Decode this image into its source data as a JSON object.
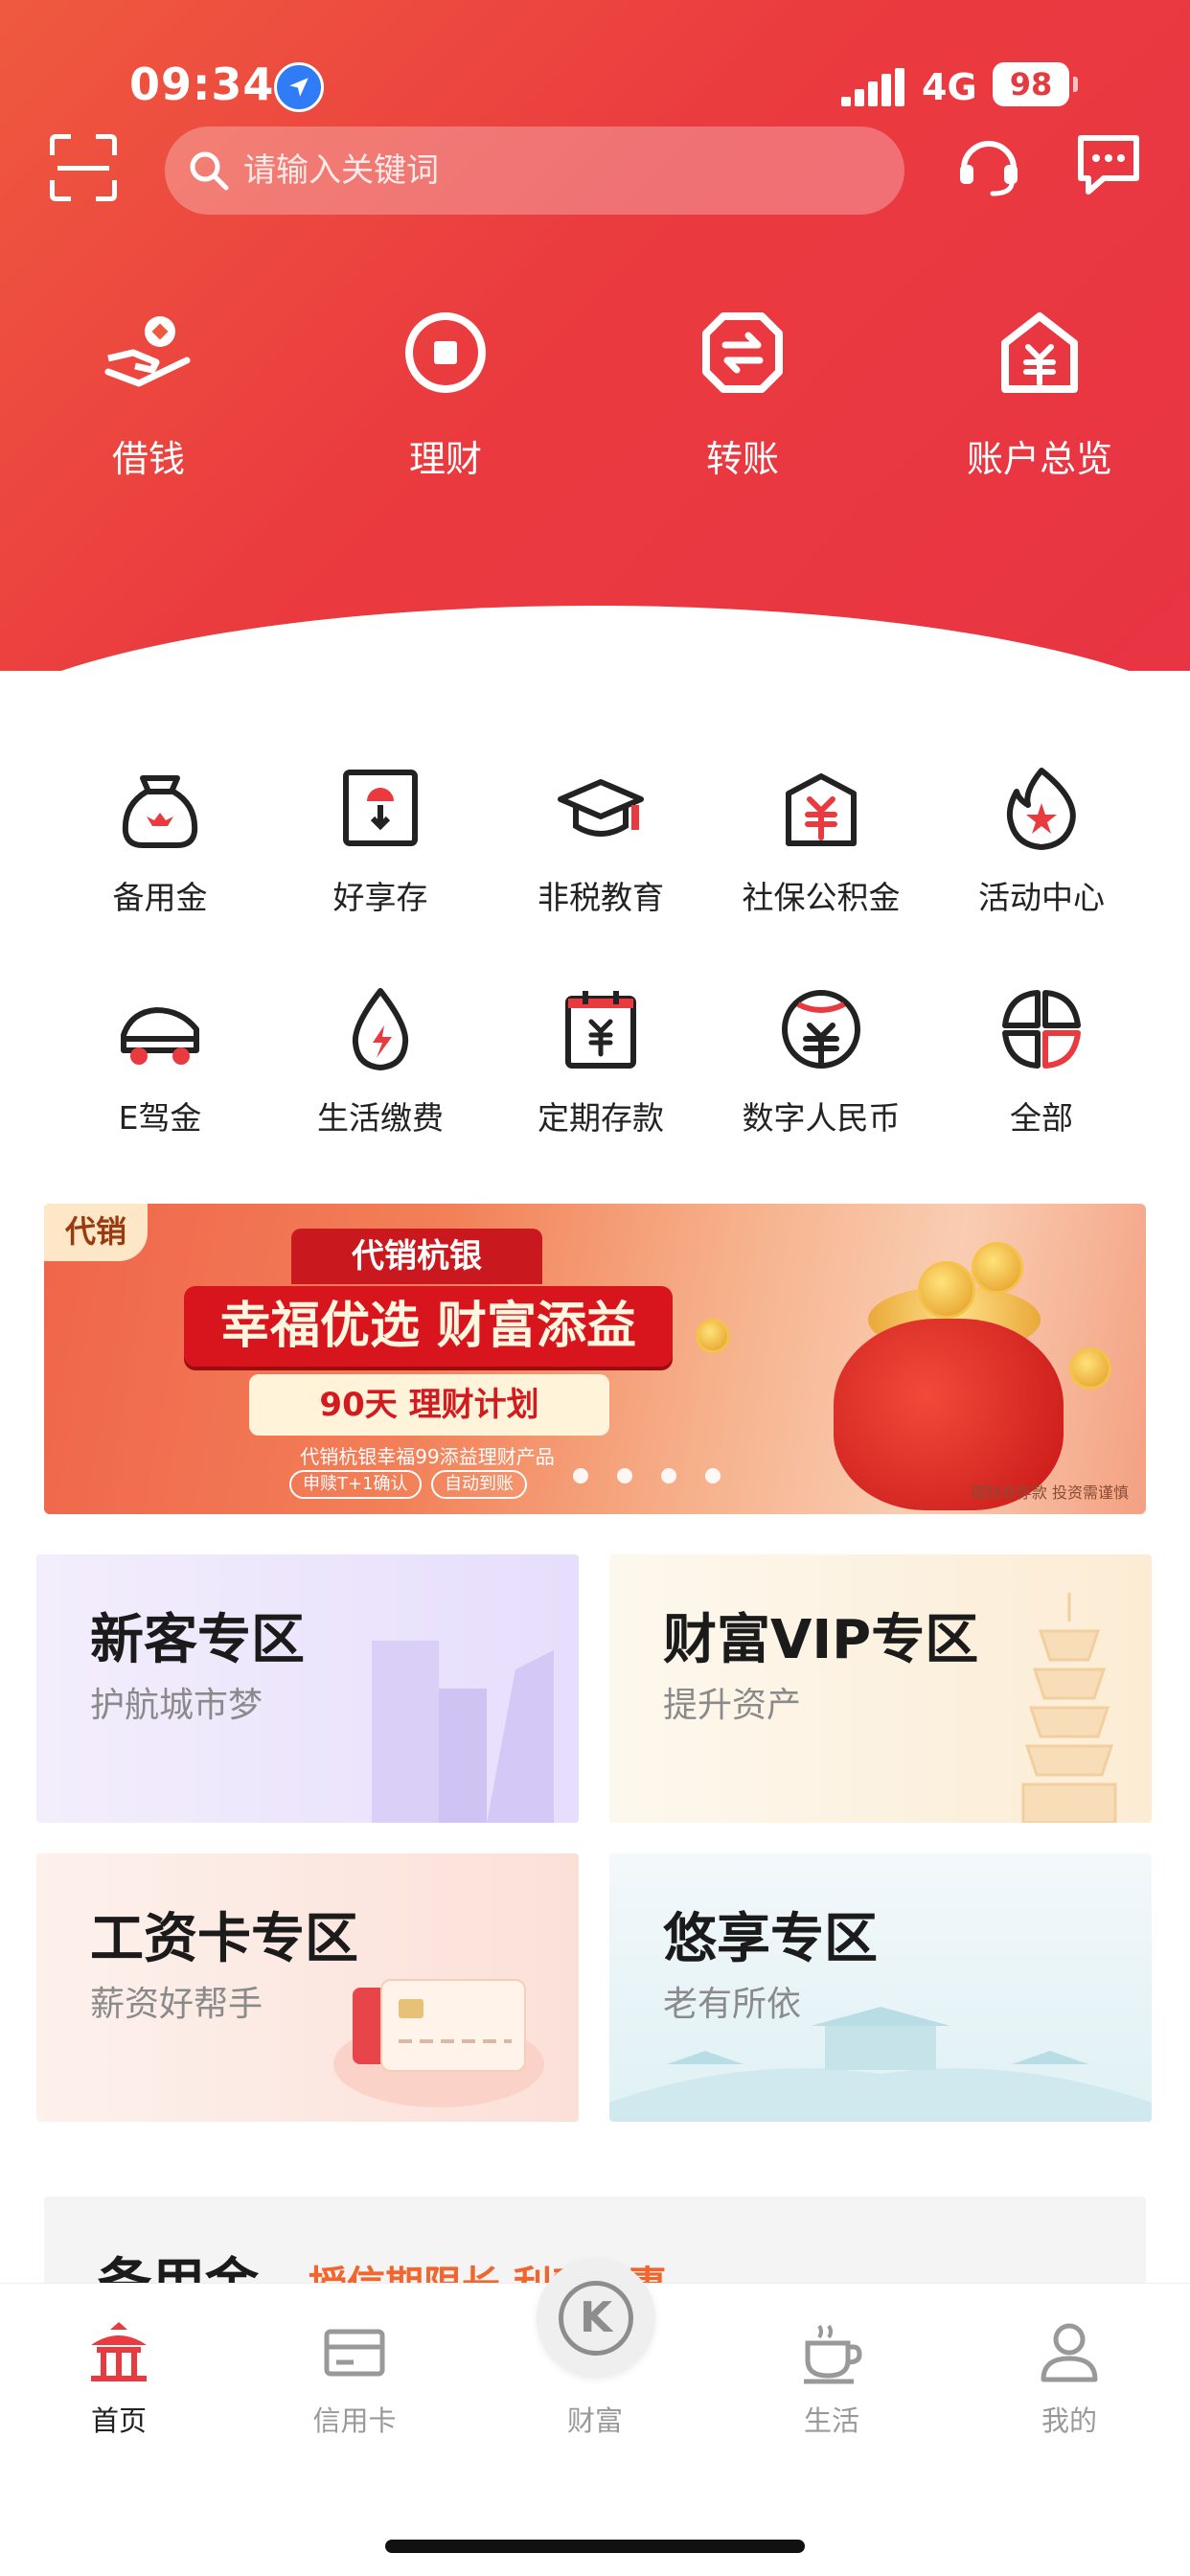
{
  "status": {
    "time": "09:34",
    "network": "4G",
    "battery": "98"
  },
  "search": {
    "placeholder": "请输入关键词"
  },
  "quick_actions": [
    {
      "label": "借钱",
      "icon": "loan-hand-icon"
    },
    {
      "label": "理财",
      "icon": "wealth-coin-icon"
    },
    {
      "label": "转账",
      "icon": "transfer-arrows-icon"
    },
    {
      "label": "账户总览",
      "icon": "account-house-icon"
    }
  ],
  "services": [
    {
      "label": "备用金",
      "icon": "reserve-bag-icon"
    },
    {
      "label": "好享存",
      "icon": "deposit-box-icon"
    },
    {
      "label": "非税教育",
      "icon": "graduation-cap-icon"
    },
    {
      "label": "社保公积金",
      "icon": "social-security-icon"
    },
    {
      "label": "活动中心",
      "icon": "flame-star-icon"
    },
    {
      "label": "E驾金",
      "icon": "car-icon"
    },
    {
      "label": "生活缴费",
      "icon": "water-drop-bolt-icon"
    },
    {
      "label": "定期存款",
      "icon": "calendar-yen-icon"
    },
    {
      "label": "数字人民币",
      "icon": "digital-rmb-icon"
    },
    {
      "label": "全部",
      "icon": "all-grid-icon"
    }
  ],
  "banner": {
    "tag": "代销",
    "top_label": "代销杭银",
    "slogan": "幸福优选 财富添益",
    "plan": "90天 理财计划",
    "product": "代销杭银幸福99添益理财产品",
    "chips": [
      "申赎T+1确认",
      "自动到账"
    ],
    "note": "理财非存款  投资需谨慎",
    "slide_count": 4
  },
  "zones": [
    {
      "title": "新客专区",
      "subtitle": "护航城市梦"
    },
    {
      "title": "财富VIP专区",
      "subtitle": "提升资产"
    },
    {
      "title": "工资卡专区",
      "subtitle": "薪资好帮手"
    },
    {
      "title": "悠享专区",
      "subtitle": "老有所依"
    }
  ],
  "peek": {
    "title": "备用金",
    "subtitle": "授信期限长  利率优惠"
  },
  "tabs": [
    {
      "label": "首页",
      "icon": "home-pavilion-icon",
      "active": true
    },
    {
      "label": "信用卡",
      "icon": "credit-card-icon",
      "active": false
    },
    {
      "label": "财富",
      "icon": "wealth-k-icon",
      "active": false
    },
    {
      "label": "生活",
      "icon": "coffee-cup-icon",
      "active": false
    },
    {
      "label": "我的",
      "icon": "user-icon",
      "active": false
    }
  ],
  "colors": {
    "brand_red": "#e83a3f",
    "accent_orange": "#f0662e"
  }
}
